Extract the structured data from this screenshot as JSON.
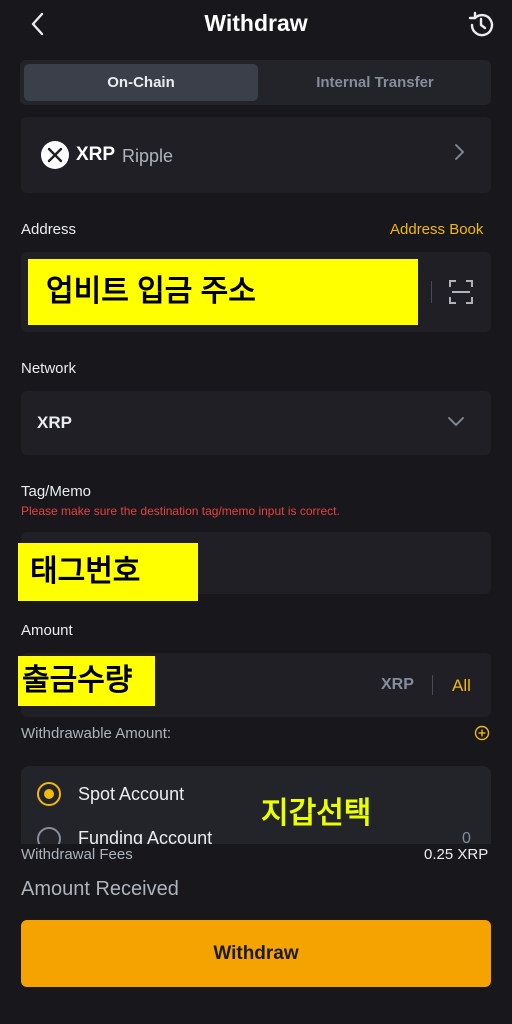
{
  "header": {
    "title": "Withdraw",
    "back_icon": "chevron-left-icon",
    "history_icon": "history-icon"
  },
  "tabs": [
    {
      "label": "On-Chain",
      "active": true
    },
    {
      "label": "Internal Transfer",
      "active": false
    }
  ],
  "coin": {
    "symbol": "XRP",
    "name": "Ripple"
  },
  "address": {
    "label": "Address",
    "book_link": "Address Book",
    "value": "업비트 입금 주소"
  },
  "network": {
    "label": "Network",
    "value": "XRP"
  },
  "tag": {
    "label": "Tag/Memo",
    "warning": "Please make sure the destination tag/memo input is correct.",
    "value": "태그번호"
  },
  "amount": {
    "label": "Amount",
    "value": "출금수량",
    "unit": "XRP",
    "all": "All",
    "withdrawable_label": "Withdrawable Amount:"
  },
  "wallet": {
    "annotation": "지갑선택",
    "options": [
      {
        "label": "Spot Account",
        "selected": true,
        "value": ""
      },
      {
        "label": "Funding Account",
        "selected": false,
        "value": "0"
      }
    ]
  },
  "fees": {
    "label": "Withdrawal Fees",
    "value": "0.25 XRP"
  },
  "received": {
    "label": "Amount Received"
  },
  "withdraw_button": "Withdraw",
  "colors": {
    "accent": "#f0b90b",
    "button": "#f5a301",
    "warning": "#e84142",
    "highlight": "#ffff00"
  }
}
